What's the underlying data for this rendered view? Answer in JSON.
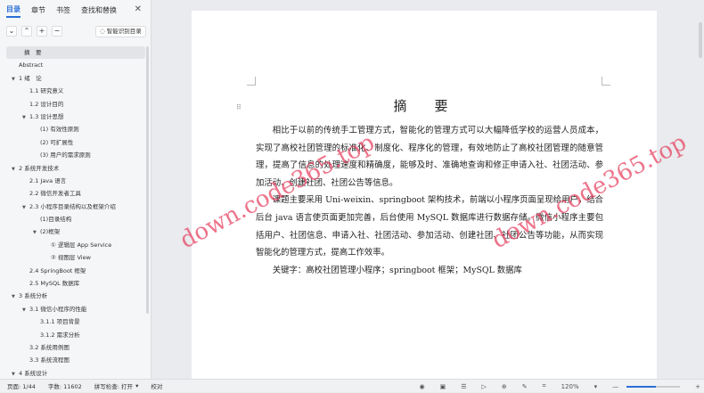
{
  "sidebar": {
    "tabs": [
      "目录",
      "章节",
      "书签",
      "查找和替换"
    ],
    "smart_toc": "智能识别目录",
    "items": [
      {
        "label": "摘　要",
        "level": 0,
        "selected": true
      },
      {
        "label": "Abstract",
        "level": 0
      },
      {
        "label": "1 绪　论",
        "level": 0,
        "arrow": true
      },
      {
        "label": "1.1 研究意义",
        "level": 1
      },
      {
        "label": "1.2 设计目的",
        "level": 1
      },
      {
        "label": "1.3 设计思想",
        "level": 1,
        "arrow": true
      },
      {
        "label": "(1) 有效性原则",
        "level": 2
      },
      {
        "label": "(2) 可扩展性",
        "level": 2
      },
      {
        "label": "(3) 用户的需求原则",
        "level": 2
      },
      {
        "label": "2 系统开发技术",
        "level": 0,
        "arrow": true
      },
      {
        "label": "2.1 Java 语言",
        "level": 1
      },
      {
        "label": "2.2 微信开发者工具",
        "level": 1
      },
      {
        "label": "2.3 小程序目录结构以及框架介绍",
        "level": 1,
        "arrow": true
      },
      {
        "label": "(1)目录结构",
        "level": 2
      },
      {
        "label": "(2)框架",
        "level": 2,
        "arrow": true
      },
      {
        "label": "① 逻辑层 App Service",
        "level": 3
      },
      {
        "label": "② 视图层 View",
        "level": 3
      },
      {
        "label": "2.4 SpringBoot 框架",
        "level": 1
      },
      {
        "label": "2.5 MySQL 数据库",
        "level": 1
      },
      {
        "label": "3 系统分析",
        "level": 0,
        "arrow": true
      },
      {
        "label": "3.1 微信小程序的性能",
        "level": 1,
        "arrow": true
      },
      {
        "label": "3.1.1 项目背景",
        "level": 2
      },
      {
        "label": "3.1.2 需求分析",
        "level": 2
      },
      {
        "label": "3.2 系统用例图",
        "level": 1
      },
      {
        "label": "3.3 系统流程图",
        "level": 1
      },
      {
        "label": "4 系统设计",
        "level": 0,
        "arrow": true
      }
    ]
  },
  "document": {
    "title": "摘　要",
    "paragraphs": [
      "相比于以前的传统手工管理方式，智能化的管理方式可以大幅降低学校的运营人员成本，实现了高校社团管理的标准化、制度化、程序化的管理，有效地防止了高校社团管理的随意管理，提高了信息的处理速度和精确度，能够及时、准确地查询和修正申请入社、社团活动、参加活动、创建社团、社团公告等信息。",
      "课题主要采用 Uni-weixin、springboot 架构技术，前端以小程序页面呈现给用户，结合后台 java 语言使页面更加完善，后台使用 MySQL 数据库进行数据存储。微信小程序主要包括用户、社团信息、申请入社、社团活动、参加活动、创建社团、社团公告等功能，从而实现智能化的管理方式，提高工作效率。",
      "关键字：高校社团管理小程序；springboot 框架；MySQL 数据库"
    ],
    "watermark": "down.code365.top"
  },
  "status": {
    "page": "页面: 1/44",
    "words": "字数: 11602",
    "spell": "拼写检查: 打开",
    "proof": "校对",
    "zoom": "120%",
    "zoom_fraction": 0.55
  },
  "colors": {
    "accent": "#2a6fd6",
    "watermark": "#e64664"
  }
}
